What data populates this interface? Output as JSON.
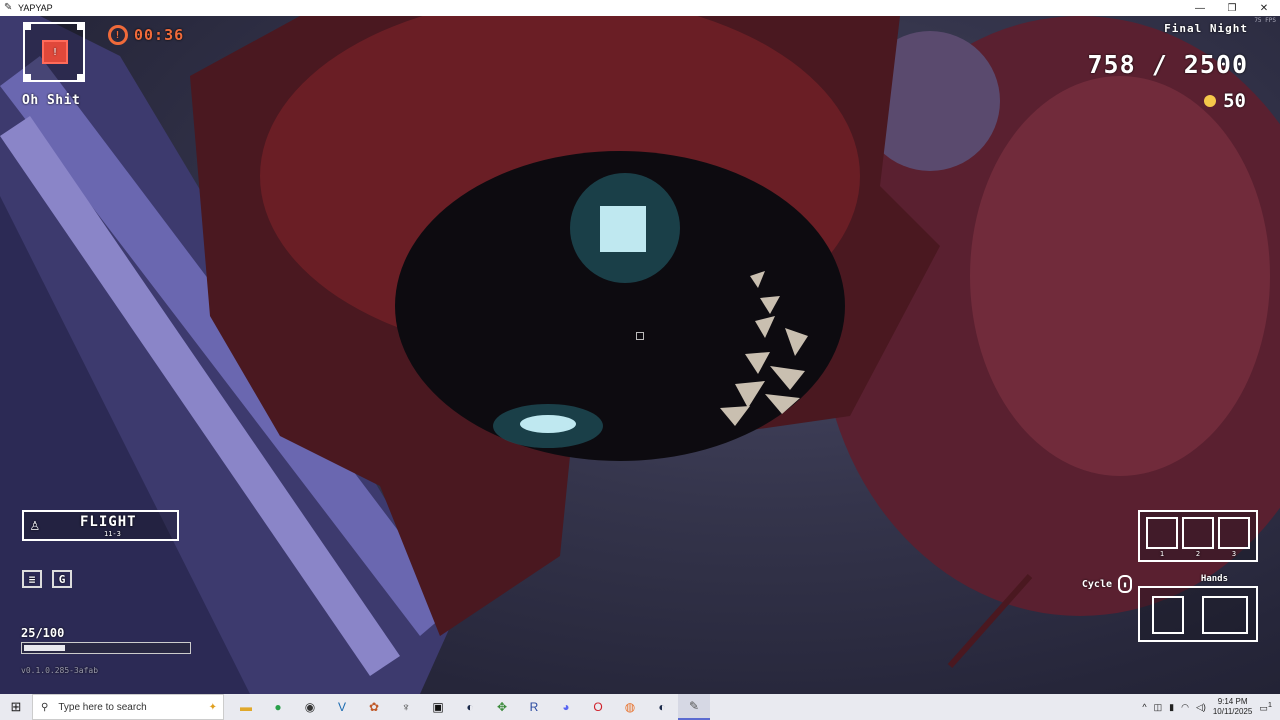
{
  "window": {
    "title": "YAPYAP",
    "minimize_icon": "minimize-icon",
    "restore_icon": "restore-icon",
    "close_icon": "close-icon"
  },
  "hud": {
    "fps": "75 FPS",
    "status_label": "Oh Shit",
    "timer": "00:36",
    "night_label": "Final Night",
    "quota": "758 / 2500",
    "coins": "50",
    "spell_name": "FLIGHT",
    "spell_sub": "11-3",
    "icons": [
      "scroll-icon",
      "g-key-icon"
    ],
    "icon_letter": "G",
    "mana": "25/100",
    "mana_fraction": 0.25,
    "version": "v0.1.0.285-3afab",
    "inventory_slots": [
      "1",
      "2",
      "3"
    ],
    "hands_label": "Hands",
    "cycle_label": "Cycle",
    "colors": {
      "timer": "#f06a3a",
      "rec": "#e0483a",
      "coin": "#f5c84a"
    }
  },
  "taskbar": {
    "search_placeholder": "Type here to search",
    "apps": [
      "file-explorer-icon",
      "xbox-icon",
      "obs-icon",
      "vscode-icon",
      "game-icon",
      "steam-vr-icon",
      "epic-games-icon",
      "steam-icon",
      "character-icon",
      "rsi-icon",
      "discord-icon",
      "opera-icon",
      "firefox-icon",
      "steam-icon-2",
      "yapyap-icon"
    ],
    "time": "9:14 PM",
    "date": "10/11/2025",
    "notifications": "1"
  }
}
